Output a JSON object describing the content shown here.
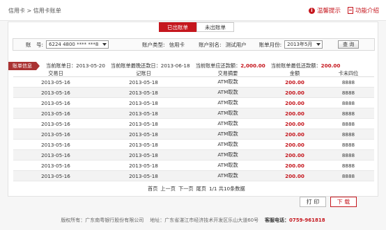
{
  "header": {
    "breadcrumb": "信用卡 > 信用卡账单",
    "tips": "温馨提示",
    "features": "功能介绍"
  },
  "tabs": [
    {
      "label": "已出账单",
      "active": true
    },
    {
      "label": "未出账单",
      "active": false
    }
  ],
  "filter": {
    "account_label": "账　号:",
    "account_value": "6224 4800 **** ***8",
    "type_label": "账户类型:",
    "type_value": "信用卡",
    "alias_label": "账户别名:",
    "alias_value": "测试用户",
    "month_label": "账单月份:",
    "month_value": "2013年5月",
    "query_label": "查 询"
  },
  "summary": {
    "tag": "账单信息",
    "bill_date": "当前账单日：2013-05-20",
    "due_date": "当前账单最晚还款日：2013-06-18",
    "due_amount_label": "当前账单应还款额：",
    "due_amount": "2,000.00",
    "min_amount_label": "当前账单最低还款额：",
    "min_amount": "200.00"
  },
  "table": {
    "columns": [
      "交易日",
      "记账日",
      "交易摘要",
      "金额",
      "卡末四位"
    ],
    "rows": [
      [
        "2013-05-16",
        "2013-05-18",
        "ATM取款",
        "200.00",
        "8888"
      ],
      [
        "2013-05-16",
        "2013-05-18",
        "ATM取款",
        "200.00",
        "8888"
      ],
      [
        "2013-05-16",
        "2013-05-18",
        "ATM取款",
        "200.00",
        "8888"
      ],
      [
        "2013-05-16",
        "2013-05-18",
        "ATM取款",
        "200.00",
        "8888"
      ],
      [
        "2013-05-16",
        "2013-05-18",
        "ATM取款",
        "200.00",
        "8888"
      ],
      [
        "2013-05-16",
        "2013-05-18",
        "ATM取款",
        "200.00",
        "8888"
      ],
      [
        "2013-05-16",
        "2013-05-18",
        "ATM取款",
        "200.00",
        "8888"
      ],
      [
        "2013-05-16",
        "2013-05-18",
        "ATM取款",
        "200.00",
        "8888"
      ],
      [
        "2013-05-16",
        "2013-05-18",
        "ATM取款",
        "200.00",
        "8888"
      ],
      [
        "2013-05-16",
        "2013-05-18",
        "ATM取款",
        "200.00",
        "8888"
      ]
    ]
  },
  "pager": {
    "first": "首页",
    "prev": "上一页",
    "next": "下一页",
    "last": "尾页",
    "info": "1/1 共10条数据"
  },
  "actions": {
    "print": "打 印",
    "download": "下 载"
  },
  "footer": {
    "copyright": "版权所有：广东南粤银行股份有限公司",
    "address": "地址：广东省湛江市经济技术开发区乐山大道60号",
    "phone_label": "客服电话：",
    "phone": "0759-961818"
  },
  "colors": {
    "brand": "#c5161d",
    "tag": "#a33333"
  }
}
